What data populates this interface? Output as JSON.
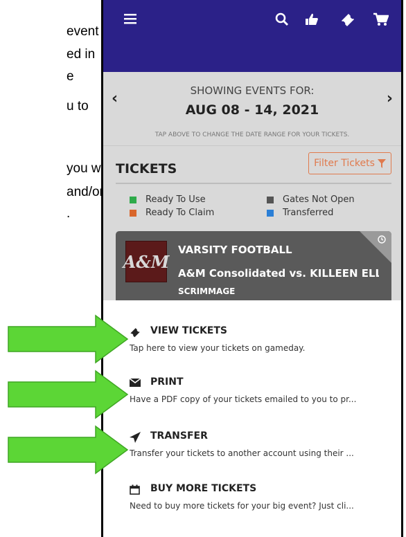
{
  "instructions": {
    "lines": [
      "event",
      "ed in",
      "e",
      "u to",
      "you will",
      "and/or",
      "."
    ]
  },
  "app": {
    "topbar_icons": [
      "menu-icon",
      "search-icon",
      "thumbs-up-icon",
      "ticket-icon",
      "cart-icon"
    ],
    "date_selector": {
      "prev": "‹",
      "next": "›",
      "showing_label": "SHOWING EVENTS FOR:",
      "range": "AUG 08 - 14, 2021",
      "hint": "TAP ABOVE TO CHANGE THE DATE RANGE FOR YOUR TICKETS."
    },
    "tickets": {
      "title": "TICKETS",
      "filter_label": "Filter Tickets"
    },
    "legend": [
      {
        "label": "Ready To Use",
        "color": "#2eaa4a"
      },
      {
        "label": "Gates Not Open",
        "color": "#555555"
      },
      {
        "label": "Ready To Claim",
        "color": "#d9662b"
      },
      {
        "label": "Transferred",
        "color": "#2b7fd6"
      }
    ],
    "event_card": {
      "logo_text": "A&M",
      "sport": "VARSITY FOOTBALL",
      "matchup": "A&M Consolidated vs. KILLEEN ELLI...",
      "event_type": "SCRIMMAGE"
    },
    "actions": [
      {
        "title": "VIEW TICKETS",
        "description": "Tap here to view your tickets on gameday.",
        "icon": "ticket-icon"
      },
      {
        "title": "PRINT",
        "description": "Have a PDF copy of your tickets emailed to you to pr...",
        "icon": "envelope-icon"
      },
      {
        "title": "TRANSFER",
        "description": "Transfer your tickets to another account using their ...",
        "icon": "paper-plane-icon"
      },
      {
        "title": "BUY MORE TICKETS",
        "description": "Need to buy more tickets for your big event? Just cli...",
        "icon": "calendar-icon"
      }
    ]
  },
  "colors": {
    "topbar": "#2b2188",
    "filter_accent": "#e07a4d",
    "arrow_green": "#5cd636",
    "card_bg": "#5a5a5a"
  }
}
